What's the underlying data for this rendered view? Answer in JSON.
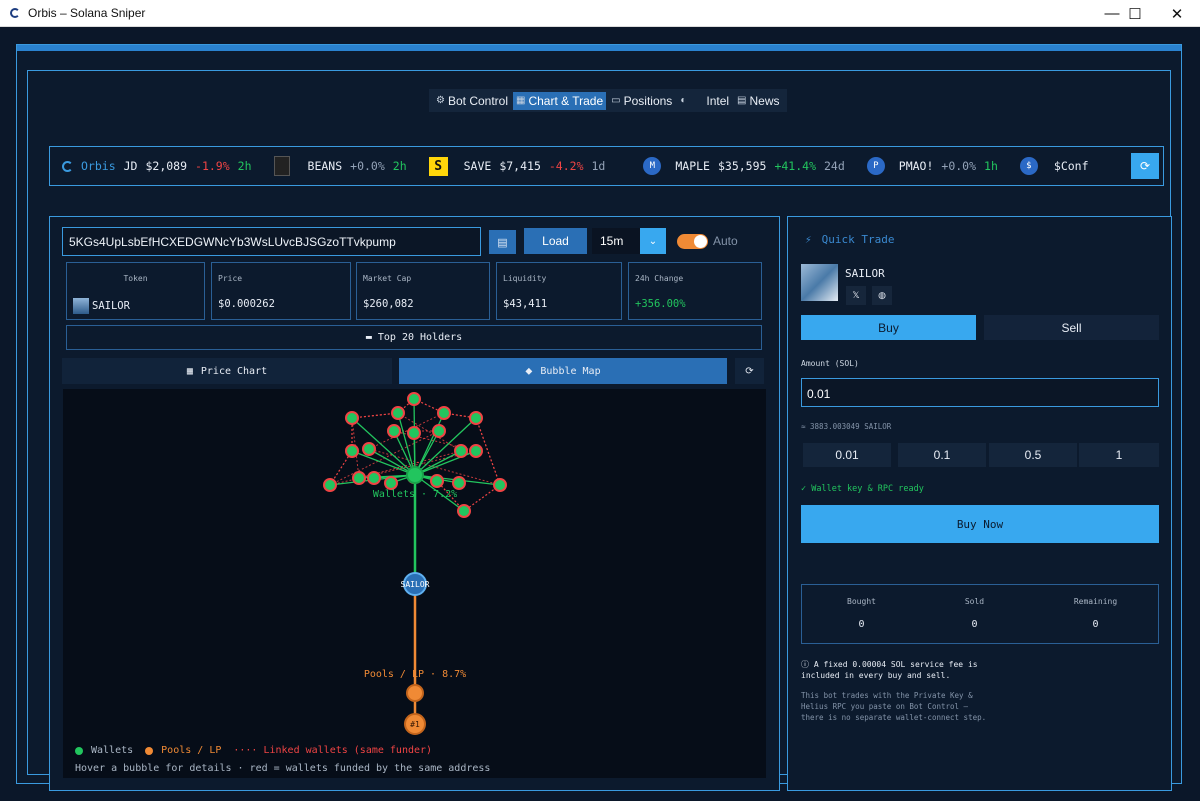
{
  "window": {
    "title": "Orbis – Solana Sniper",
    "minimize": "—",
    "maximize": "☐",
    "close": "✕"
  },
  "nav": {
    "tabs": [
      {
        "label": "Bot Control",
        "icon": "⚙"
      },
      {
        "label": "Chart & Trade",
        "icon": "▦"
      },
      {
        "label": "Positions",
        "icon": "▭"
      },
      {
        "label": "",
        "icon": "◐"
      },
      {
        "label": "Intel",
        "icon": ""
      },
      {
        "label": "News",
        "icon": "▤"
      }
    ],
    "active": "Chart & Trade"
  },
  "ticker": {
    "items": [
      {
        "name": "Orbis",
        "symbol": "JD",
        "price": "$2,089",
        "change": "-1.9%",
        "tf": "2h"
      },
      {
        "name": "BEANS",
        "price": "+0.0%",
        "change": "",
        "tf": "2h"
      },
      {
        "name": "SAVE",
        "badge": "S",
        "price": "$7,415",
        "change": "-4.2%",
        "tf": "1d"
      },
      {
        "name": "MAPLE",
        "badge": "M",
        "price": "$35,595",
        "change": "+41.4%",
        "tf": "24d"
      },
      {
        "name": "PMAO!",
        "badge": "P",
        "price": "+0.0%",
        "change": "",
        "tf": "1h"
      },
      {
        "name": "$Conf",
        "badge": "$"
      }
    ],
    "refresh_icon": "⟳"
  },
  "token_panel": {
    "contract": "5KGs4UpLsbEfHCXEDGWNcYb3WsLUvcBJSGzoTTvkpump",
    "load_label": "Load",
    "timeframe": "15m",
    "auto_label": "Auto",
    "stats": [
      {
        "label": "Token",
        "value": "SAILOR"
      },
      {
        "label": "Price",
        "value": "$0.000262"
      },
      {
        "label": "Market Cap",
        "value": "$260,082"
      },
      {
        "label": "Liquidity",
        "value": "$43,411"
      },
      {
        "label": "24h Change",
        "value": "+356.00%"
      }
    ],
    "holders_label": "Top 20 Holders",
    "view_tabs": {
      "price": "Price Chart",
      "bubble": "Bubble Map"
    },
    "map": {
      "wallets_label": "Wallets · 7.2%",
      "token_label": "SAILOR",
      "pools_label": "Pools / LP · 8.7%",
      "lp_rank": "#1",
      "legend": {
        "wallets": "Wallets",
        "pools": "Pools / LP",
        "linked": "Linked wallets (same funder)"
      },
      "hint": "Hover a bubble for details · red = wallets funded by the same address"
    }
  },
  "quick_trade": {
    "title": "Quick Trade",
    "token": "SAILOR",
    "buy_label": "Buy",
    "sell_label": "Sell",
    "amount_label": "Amount (SOL)",
    "amount_value": "0.01",
    "estimate": "≈ 3883.003049 SAILOR",
    "presets": [
      "0.01",
      "0.1",
      "0.5",
      "1"
    ],
    "ready": "✓ Wallet key & RPC ready",
    "buy_now": "Buy Now",
    "position": [
      {
        "label": "Bought",
        "value": "0"
      },
      {
        "label": "Sold",
        "value": "0"
      },
      {
        "label": "Remaining",
        "value": "0"
      }
    ],
    "fee_note": "ⓘ A fixed 0.00004 SOL service fee is included in every buy and sell.",
    "info_note": "This bot trades with the Private Key & Helius RPC you paste on Bot Control — there is no separate wallet-connect step."
  },
  "colors": {
    "accent": "#38a8ef",
    "border": "#3a9adf",
    "wallet": "#22c55e",
    "pool": "#f08a35",
    "linked": "#ef4444"
  }
}
